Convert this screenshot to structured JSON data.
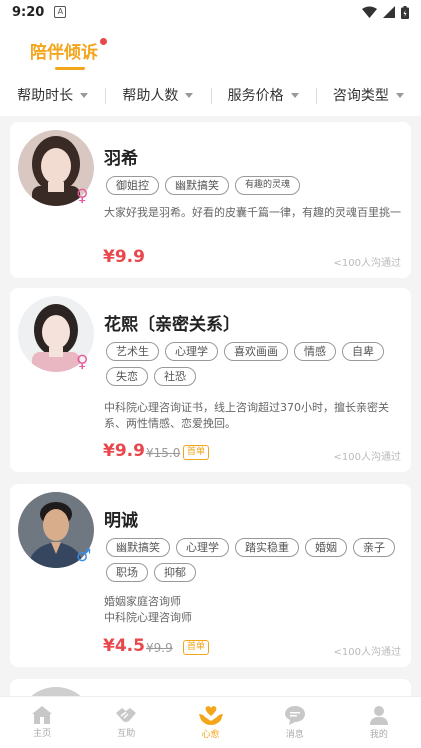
{
  "status": {
    "time": "9:20",
    "notice": "A"
  },
  "header": {
    "title": "陪伴倾诉"
  },
  "filters": [
    {
      "label": "帮助时长"
    },
    {
      "label": "帮助人数"
    },
    {
      "label": "服务价格"
    },
    {
      "label": "咨询类型"
    }
  ],
  "counselors": [
    {
      "name": "羽希",
      "gender": "♀",
      "tags": [
        "御姐控",
        "幽默搞笑",
        "有趣的灵魂"
      ],
      "description": "大家好我是羽希。好看的皮囊千篇一律，有趣的灵魂百里挑一",
      "price": "¥9.9",
      "passed": "<100人沟通过"
    },
    {
      "name": "花熙〔亲密关系〕",
      "gender": "♀",
      "tags": [
        "艺术生",
        "心理学",
        "喜欢画画",
        "情感",
        "自卑",
        "失恋",
        "社恐"
      ],
      "description": "中科院心理咨询证书，线上咨询超过370小时，擅长亲密关系、两性情感、恋爱挽回。",
      "price": "¥9.9",
      "original_price": "¥15.0",
      "badge": "首单",
      "passed": "<100人沟通过"
    },
    {
      "name": "明诚",
      "gender": "♂",
      "tags": [
        "幽默搞笑",
        "心理学",
        "踏实稳重",
        "婚姻",
        "亲子",
        "职场",
        "抑郁"
      ],
      "description_lines": [
        "婚姻家庭咨询师",
        "中科院心理咨询师"
      ],
      "price": "¥4.5",
      "original_price": "¥9.9",
      "badge": "首单",
      "passed": "<100人沟通过"
    }
  ],
  "tabbar": [
    {
      "label": "主页",
      "icon": "home-icon"
    },
    {
      "label": "互助",
      "icon": "handshake-icon"
    },
    {
      "label": "心愈",
      "icon": "heart-hands-icon",
      "active": true
    },
    {
      "label": "消息",
      "icon": "chat-icon"
    },
    {
      "label": "我的",
      "icon": "user-icon"
    }
  ],
  "colors": {
    "accent": "#f3a51c",
    "price": "#e8474c",
    "female": "#e8589a",
    "male": "#3a8ee6"
  }
}
